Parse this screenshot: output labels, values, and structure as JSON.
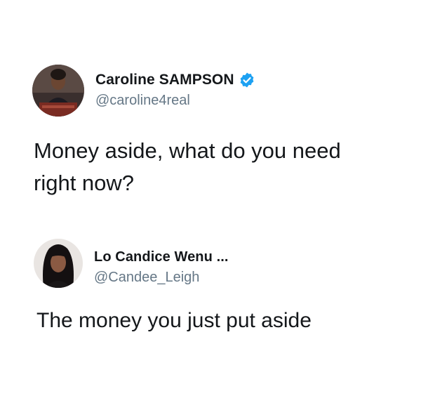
{
  "tweets": [
    {
      "display_name": "Caroline SAMPSON",
      "handle": "@caroline4real",
      "verified": true,
      "text_line_1": "Money aside, what do you need",
      "text_line_2": "right now?",
      "avatar_icon": "profile-photo"
    },
    {
      "display_name": "Lo Candice Wenu ...",
      "handle": "@Candee_Leigh",
      "verified": false,
      "text_line_1": "The money you just put aside",
      "avatar_icon": "profile-photo"
    }
  ],
  "colors": {
    "text": "#14171a",
    "handle": "#657786",
    "verified_badge": "#1da1f2",
    "background": "#ffffff"
  }
}
